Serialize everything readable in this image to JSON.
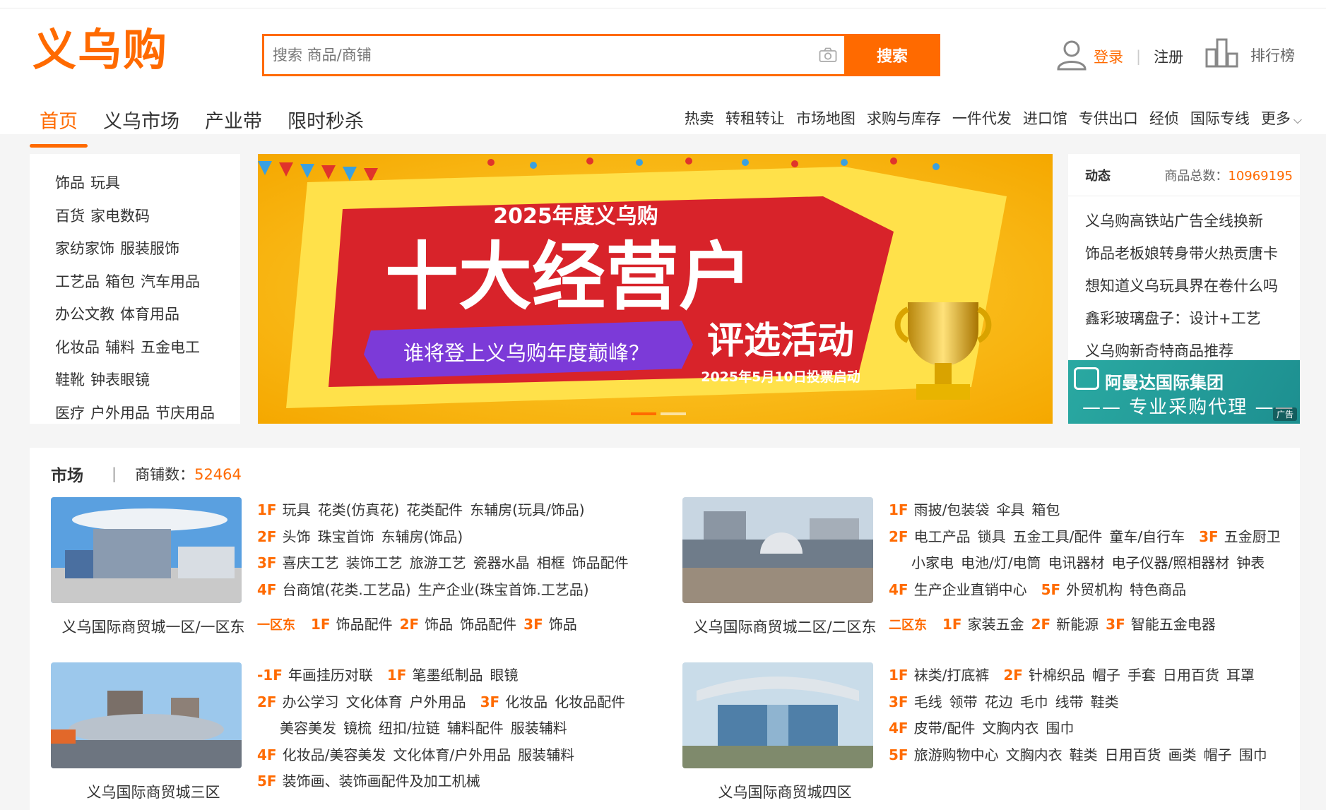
{
  "brand": {
    "logo": "义乌购",
    "accent": "#ff6a00"
  },
  "search": {
    "placeholder": "搜索 商品/商铺",
    "button": "搜索"
  },
  "account": {
    "login": "登录",
    "register": "注册",
    "ranking": "排行榜"
  },
  "main_nav": [
    "首页",
    "义乌市场",
    "产业带",
    "限时秒杀"
  ],
  "sub_nav": [
    "热卖",
    "转租转让",
    "市场地图",
    "求购与库存",
    "一件代发",
    "进口馆",
    "专供出口",
    "经侦",
    "国际专线"
  ],
  "sub_nav_more": "更多",
  "categories": [
    [
      "饰品",
      "玩具"
    ],
    [
      "百货",
      "家电数码"
    ],
    [
      "家纺家饰",
      "服装服饰"
    ],
    [
      "工艺品",
      "箱包",
      "汽车用品"
    ],
    [
      "办公文教",
      "体育用品"
    ],
    [
      "化妆品",
      "辅料",
      "五金电工"
    ],
    [
      "鞋靴",
      "钟表眼镜"
    ],
    [
      "医疗",
      "户外用品",
      "节庆用品"
    ]
  ],
  "banner": {
    "line1": "2025年度义乌购",
    "line2": "十大经营户",
    "line3": "谁将登上义乌购年度巅峰？",
    "line4": "评选活动",
    "line5": "2025年5月10日投票启动",
    "slide_active": 1,
    "slide_count": 2
  },
  "news": {
    "title": "动态",
    "count_label": "商品总数：",
    "count_value": "10969195",
    "items": [
      "义乌购高铁站广告全线换新",
      "饰品老板娘转身带火热贡唐卡",
      "想知道义乌玩具界在卷什么吗",
      "鑫彩玻璃盘子：设计+工艺",
      "义乌购新奇特商品推荐"
    ],
    "ad": {
      "company": "阿曼达国际集团",
      "slogan": "—— 专业采购代理 ——",
      "tag": "广告"
    }
  },
  "market": {
    "title": "市场",
    "shops_label": "商铺数：",
    "shops_value": "52464",
    "blocks": [
      {
        "caption": "义乌国际商贸城一区/一区东",
        "lines": [
          {
            "floor": "1F",
            "items": [
              "玩具",
              "花类(仿真花)",
              "花类配件",
              "东辅房(玩具/饰品)"
            ]
          },
          {
            "floor": "2F",
            "items": [
              "头饰",
              "珠宝首饰",
              "东辅房(饰品)"
            ]
          },
          {
            "floor": "3F",
            "items": [
              "喜庆工艺",
              "装饰工艺",
              "旅游工艺",
              "瓷器水晶",
              "相框",
              "饰品配件"
            ]
          },
          {
            "floor": "4F",
            "items": [
              "台商馆(花类.工艺品)",
              "生产企业(珠宝首饰.工艺品)"
            ]
          }
        ],
        "zone": {
          "name": "一区东",
          "parts": [
            {
              "floor": "1F",
              "items": [
                "饰品配件"
              ]
            },
            {
              "floor": "2F",
              "items": [
                "饰品",
                "饰品配件"
              ]
            },
            {
              "floor": "3F",
              "items": [
                "饰品"
              ]
            }
          ]
        }
      },
      {
        "caption": "义乌国际商贸城二区/二区东",
        "lines": [
          {
            "floor": "1F",
            "items": [
              "雨披/包装袋",
              "伞具",
              "箱包"
            ]
          },
          {
            "floor": "2F",
            "items": [
              "电工产品",
              "锁具",
              "五金工具/配件",
              "童车/自行车"
            ],
            "floor2": "3F",
            "items2": [
              "五金厨卫"
            ]
          },
          {
            "floor": "",
            "items": [
              "小家电",
              "电池/灯/电筒",
              "电讯器材",
              "电子仪器/照相器材",
              "钟表"
            ]
          },
          {
            "floor": "4F",
            "items": [
              "生产企业直销中心"
            ],
            "floor2": "5F",
            "items2": [
              "外贸机构",
              "特色商品"
            ]
          }
        ],
        "zone": {
          "name": "二区东",
          "parts": [
            {
              "floor": "1F",
              "items": [
                "家装五金"
              ]
            },
            {
              "floor": "2F",
              "items": [
                "新能源"
              ]
            },
            {
              "floor": "3F",
              "items": [
                "智能五金电器"
              ]
            }
          ]
        }
      },
      {
        "caption": "义乌国际商贸城三区",
        "lines": [
          {
            "floor": "-1F",
            "items": [
              "年画挂历对联"
            ],
            "floor2": "1F",
            "items2": [
              "笔墨纸制品",
              "眼镜"
            ]
          },
          {
            "floor": "2F",
            "items": [
              "办公学习",
              "文化体育",
              "户外用品"
            ],
            "floor2": "3F",
            "items2": [
              "化妆品",
              "化妆品配件"
            ]
          },
          {
            "floor": "",
            "items": [
              "美容美发",
              "镜梳",
              "纽扣/拉链",
              "辅料配件",
              "服装辅料"
            ]
          },
          {
            "floor": "4F",
            "items": [
              "化妆品/美容美发",
              "文化体育/户外用品",
              "服装辅料"
            ]
          },
          {
            "floor": "5F",
            "items": [
              "装饰画、装饰画配件及加工机械"
            ]
          }
        ]
      },
      {
        "caption": "义乌国际商贸城四区",
        "lines": [
          {
            "floor": "1F",
            "items": [
              "袜类/打底裤"
            ],
            "floor2": "2F",
            "items2": [
              "针棉织品",
              "帽子",
              "手套",
              "日用百货",
              "耳罩"
            ]
          },
          {
            "floor": "3F",
            "items": [
              "毛线",
              "领带",
              "花边",
              "毛巾",
              "线带",
              "鞋类"
            ]
          },
          {
            "floor": "4F",
            "items": [
              "皮带/配件",
              "文胸内衣",
              "围巾"
            ]
          },
          {
            "floor": "5F",
            "items": [
              "旅游购物中心",
              "文胸内衣",
              "鞋类",
              "日用百货",
              "画类",
              "帽子",
              "围巾"
            ]
          }
        ]
      }
    ]
  }
}
